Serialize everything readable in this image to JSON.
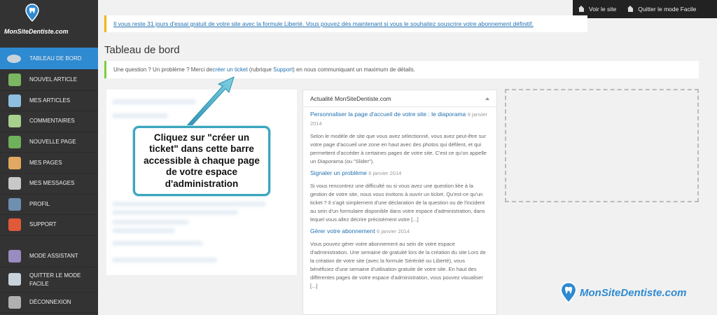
{
  "sidebar": {
    "brand": "MonSiteDentiste.com",
    "items": [
      {
        "label": "TABLEAU DE BORD",
        "icon": "dashboard-icon",
        "color": "#c9d3dc"
      },
      {
        "label": "NOUVEL ARTICLE",
        "icon": "new-article-icon",
        "color": "#7bb661"
      },
      {
        "label": "MES ARTICLES",
        "icon": "articles-icon",
        "color": "#8fbfe0"
      },
      {
        "label": "COMMENTAIRES",
        "icon": "comments-icon",
        "color": "#a8d08d"
      },
      {
        "label": "NOUVELLE PAGE",
        "icon": "new-page-icon",
        "color": "#6fb05a"
      },
      {
        "label": "MES PAGES",
        "icon": "pages-icon",
        "color": "#e0a860"
      },
      {
        "label": "MES MESSAGES",
        "icon": "messages-icon",
        "color": "#c8c8c8"
      },
      {
        "label": "PROFIL",
        "icon": "profile-icon",
        "color": "#6f8fb0"
      },
      {
        "label": "SUPPORT",
        "icon": "support-icon",
        "color": "#e05a3a"
      }
    ],
    "bottom_items": [
      {
        "label": "MODE ASSISTANT",
        "icon": "assistant-icon",
        "color": "#9a8cc0"
      },
      {
        "label": "QUITTER LE MODE FACILE",
        "icon": "quit-easy-mode-icon",
        "color": "#c9d3dc"
      },
      {
        "label": "DÉCONNEXION",
        "icon": "logout-icon",
        "color": "#b0b0b0"
      }
    ]
  },
  "topbar": {
    "view_site": "Voir le site",
    "quit_easy": "Quitter le mode Facile"
  },
  "notice": {
    "text": "Il vous reste 31 jours d'essai gratuit de votre site avec la formule Liberté. Vous pouvez dès maintenant si vous le souhaitez souscrire votre abonnement définitif."
  },
  "page_title": "Tableau de bord",
  "helpbar": {
    "before": "Une question ? Un problème ? Merci de ",
    "link": "créer un ticket",
    "middle": " (rubrique ",
    "link2": "Support",
    "after": ") en nous communiquant un maximum de détails."
  },
  "callout": {
    "text": "Cliquez sur \"créer un ticket\" dans cette barre accessible à chaque page de votre espace d'administration"
  },
  "news": {
    "title": "Actualité MonSiteDentiste.com",
    "articles": [
      {
        "title": "Personnaliser la page d'accueil de votre site : le diaporama",
        "date": "9 janvier 2014",
        "excerpt": "Selon le modèle de site que vous avez sélectionné, vous avez peut-être sur votre page d'accueil une zone en haut avec des photos qui défilent, et qui permettent d'accéder à certaines pages de votre site. C'est ce qu'on appelle un Diaporama (ou \"Slider\")."
      },
      {
        "title": "Signaler un problème",
        "date": "6 janvier 2014",
        "excerpt": "Si vous rencontrez une difficulté ou si vous avez une question liée à la gestion de votre site, nous vous invitons à ouvrir un ticket. Qu'est-ce qu'un ticket ? Il s'agit simplement d'une déclaration de la question ou de l'incident au sein d'un formulaire disponible dans votre espace d'administration, dans lequel vous allez décrire précisément votre [...]"
      },
      {
        "title": "Gérer votre abonnement",
        "date": "6 janvier 2014",
        "excerpt": "Vous pouvez gérer votre abonnement au sein de votre espace d'administration. Une semaine de gratuité lors de la création du site Lors de la création de votre site (avec la formule Sérénité ou Liberté), vous bénéficiez d'une semaine d'utilisation gratuite de votre site. En haut des différentes pages de votre espace d'administration, vous pouvez visualiser [...]"
      }
    ]
  },
  "brand_logo": "MonSiteDentiste.com",
  "colors": {
    "accent": "#2e8ad1",
    "callout_border": "#3aa6be",
    "notice_border": "#f0b400",
    "help_border": "#7ad03a"
  }
}
